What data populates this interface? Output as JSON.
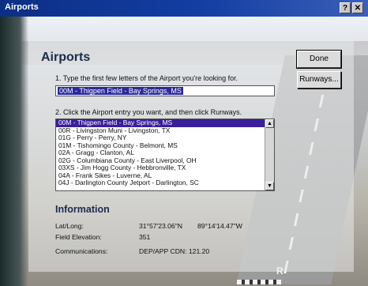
{
  "window": {
    "title": "Airports",
    "help_label": "?",
    "close_label": "✕"
  },
  "dialog": {
    "heading": "Airports",
    "done_label": "Done",
    "runways_label": "Runways...",
    "step1_label": "1.  Type the first few letters of the Airport you're looking for.",
    "search_value": "00M - Thigpen Field - Bay Springs, MS",
    "step2_label": "2.  Click the Airport entry you want, and then click Runways.",
    "airports": [
      "00M - Thigpen Field - Bay Springs, MS",
      "00R - Livingston Muni - Livingston, TX",
      "01G - Perry - Perry, NY",
      "01M - Tishomingo County - Belmont, MS",
      "02A - Gragg - Clanton, AL",
      "02G - Columbiana County - East Liverpool, OH",
      "03XS - Jim Hogg County - Hebbronville, TX",
      "04A - Frank Sikes - Luverne, AL",
      "04J - Darlington County Jetport - Darlington, SC"
    ],
    "selected_index": 0,
    "info": {
      "heading": "Information",
      "latlong_label": "Lat/Long:",
      "lat_value": "31°57'23.06\"N",
      "long_value": "89°14'14.47\"W",
      "elevation_label": "Field Elevation:",
      "elevation_value": "351",
      "comms_label": "Communications:",
      "comms_value": "DEP/APP CDN: 121.20"
    }
  },
  "scene": {
    "runway_letter": "R"
  },
  "colors": {
    "titlebar": "#0c2f86",
    "selection": "#3a1e9a",
    "heading": "#1c2b4d"
  }
}
